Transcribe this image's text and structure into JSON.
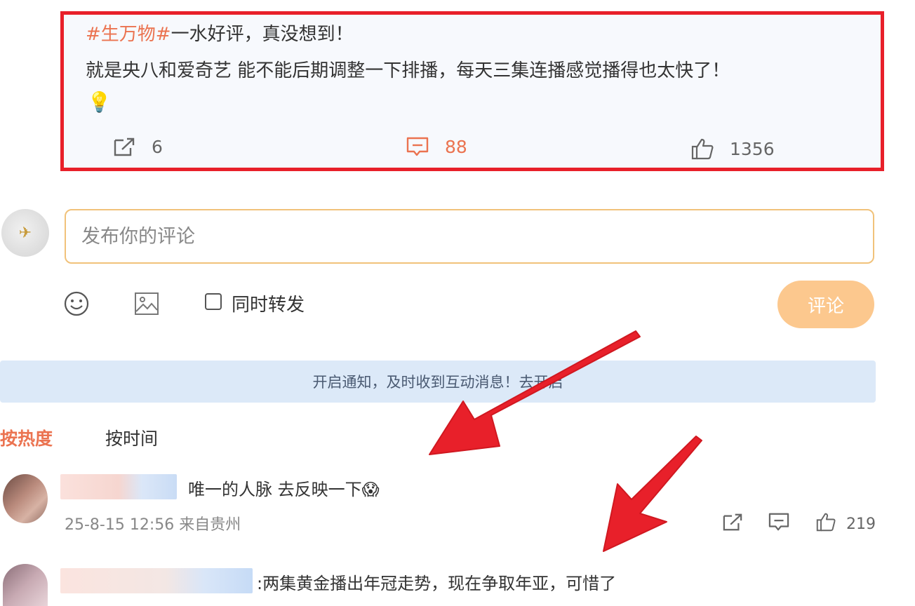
{
  "post": {
    "tag": "#生万物#",
    "line1_rest": "一水好评，真没想到！",
    "line2": "就是央八和爱奇艺 能不能后期调整一下排播，每天三集连播感觉播得也太快了！",
    "emoji": "💡",
    "share_count": "6",
    "comment_count": "88",
    "like_count": "1356"
  },
  "composer": {
    "placeholder": "发布你的评论",
    "repost_label": "同时转发",
    "submit_label": "评论"
  },
  "notification": {
    "text": "开启通知，及时收到互动消息！去开启"
  },
  "sort": {
    "hot": "按热度",
    "time": "按时间"
  },
  "comments": [
    {
      "text": "唯一的人脉 去反映一下😱",
      "meta": "25-8-15 12:56 来自贵州",
      "like_count": "219"
    },
    {
      "text": ":两集黄金播出年冠走势，现在争取年亚，可惜了"
    }
  ],
  "colors": {
    "highlight_border": "#e8202a",
    "accent": "#eb7350",
    "submit_button": "#fcc88e",
    "notification_bg": "#dce9f8"
  }
}
